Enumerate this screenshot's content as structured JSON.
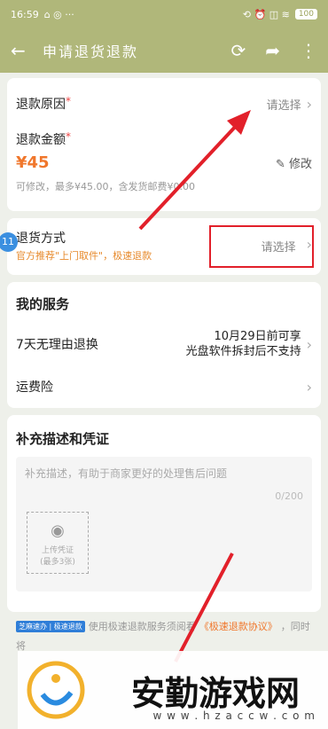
{
  "status_bar": {
    "time": "16:59",
    "left_icons": "⌂ ◎ ···",
    "right_icons": "⟲ ⏰ ◫ ≋",
    "battery": "100"
  },
  "nav": {
    "title": "申请退货退款"
  },
  "refund": {
    "reason_label": "退款原因",
    "reason_value": "请选择",
    "amount_label": "退款金额",
    "amount_value": "¥45",
    "amount_hint": "可修改，最多¥45.00，含发货邮费¥0.00",
    "edit_label": "修改"
  },
  "return_method": {
    "label": "退货方式",
    "sub": "官方推荐\"上门取件\"，极速退款",
    "value": "请选择"
  },
  "services": {
    "title": "我的服务",
    "items": [
      {
        "label": "7天无理由退换",
        "value_line1": "10月29日前可享",
        "value_line2": "光盘软件拆封后不支持"
      },
      {
        "label": "运费险"
      }
    ]
  },
  "evidence": {
    "title": "补充描述和凭证",
    "placeholder": "补充描述，有助于商家更好的处理售后问题",
    "count": "0/200",
    "upload_label": "上传凭证",
    "upload_sub": "(最多3张)"
  },
  "agreement": {
    "tag": "芝麻速办 | 极速退款",
    "text": "使用极速退款服务须阅看",
    "link": "《极速退款协议》",
    "suffix": "，同时",
    "line2_start": "将"
  },
  "watermark": {
    "text": "安勤游戏网",
    "url": "w w w . h z a c c w . c o m"
  },
  "float_badge": "11"
}
